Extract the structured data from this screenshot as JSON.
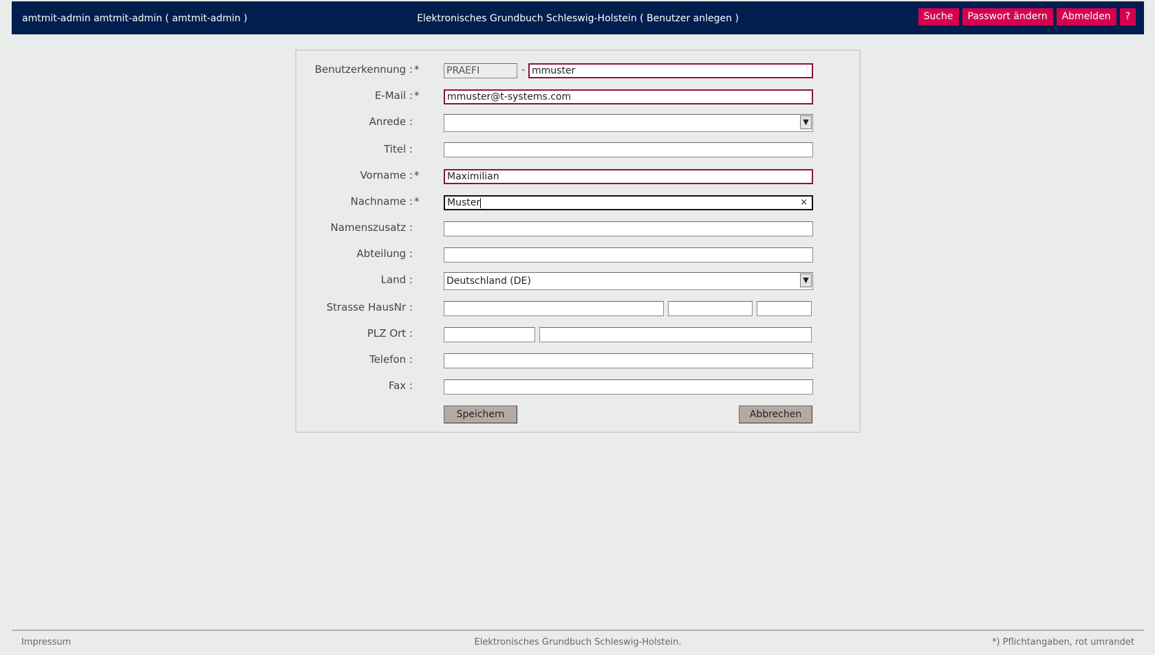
{
  "header": {
    "user": "amtmit-admin amtmit-admin  ( amtmit-admin )",
    "title": "Elektronisches Grundbuch Schleswig-Holstein  ( Benutzer anlegen )",
    "nav": [
      "Suche",
      "Passwort ändern",
      "Abmelden",
      "?"
    ]
  },
  "form": {
    "benutzerkennung": {
      "label": "Benutzerkennung :",
      "required": "*",
      "prefix": "PRAEFI",
      "separator": "-",
      "value": "mmuster"
    },
    "email": {
      "label": "E-Mail :",
      "required": "*",
      "value": "mmuster@t-systems.com"
    },
    "anrede": {
      "label": "Anrede :",
      "value": ""
    },
    "titel": {
      "label": "Titel :",
      "value": ""
    },
    "vorname": {
      "label": "Vorname :",
      "required": "*",
      "value": "Maximilian"
    },
    "nachname": {
      "label": "Nachname :",
      "required": "*",
      "value": "Muster",
      "clear": "×"
    },
    "namenszusatz": {
      "label": "Namenszusatz :",
      "value": ""
    },
    "abteilung": {
      "label": "Abteilung :",
      "value": ""
    },
    "land": {
      "label": "Land :",
      "value": "Deutschland (DE)"
    },
    "strasse": {
      "label": "Strasse HausNr :",
      "street": "",
      "number": "",
      "suffix": ""
    },
    "plzort": {
      "label": "PLZ Ort :",
      "plz": "",
      "ort": ""
    },
    "telefon": {
      "label": "Telefon :",
      "value": ""
    },
    "fax": {
      "label": "Fax :",
      "value": ""
    },
    "save_label": "Speichern",
    "cancel_label": "Abbrechen",
    "select_arrow": "chevron-down-icon"
  },
  "footer": {
    "impressum": "Impressum",
    "center": "Elektronisches Grundbuch Schleswig-Holstein.",
    "note": "*) Pflichtangaben, rot umrandet"
  },
  "colors": {
    "header_bg": "#001f4e",
    "nav_button": "#d6004f",
    "required_border": "#8e1232",
    "page_bg": "#e9ecea",
    "button_bg": "#b5a9a4"
  }
}
